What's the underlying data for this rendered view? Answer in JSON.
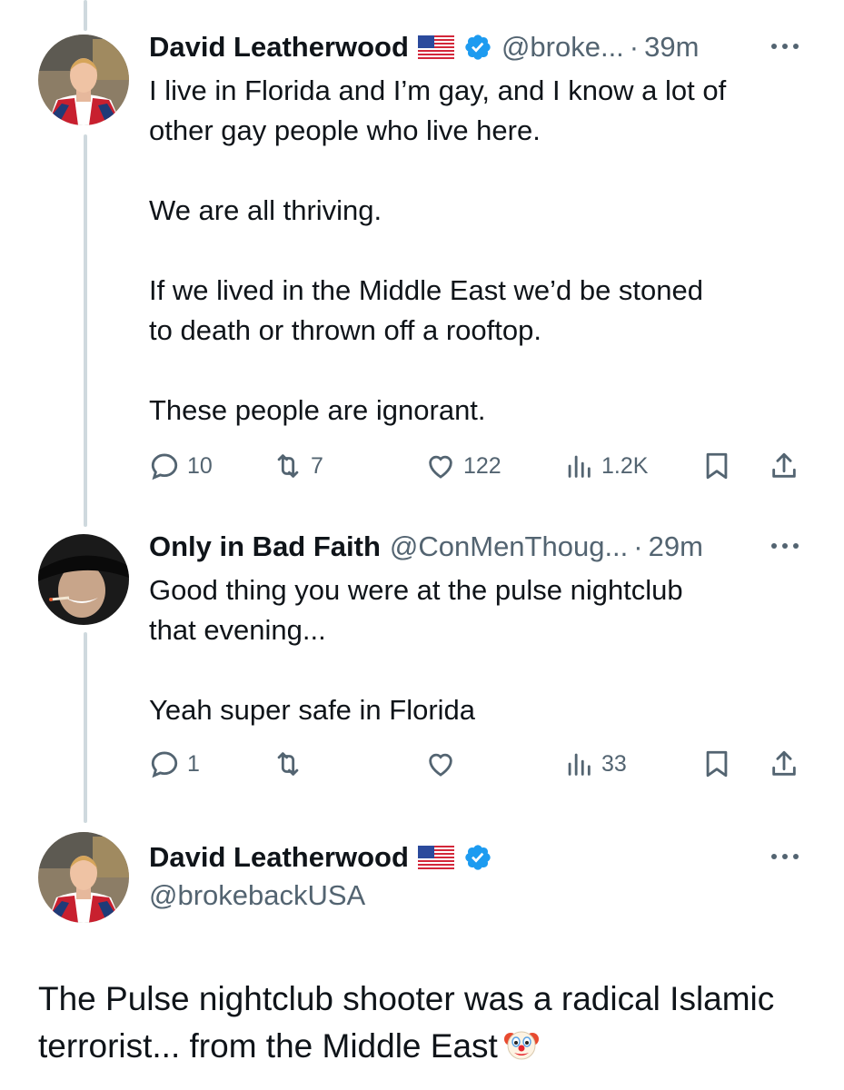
{
  "tweets": [
    {
      "name": "David Leatherwood",
      "handle": "@broke...",
      "time": "39m",
      "text": "I live in Florida and I’m gay, and I know a lot of\nother gay people who live here.\n\nWe are all thriving.\n\nIf we lived in the Middle East we’d be stoned\nto death or thrown off a rooftop.\n\nThese people are ignorant.",
      "replies": "10",
      "retweets": "7",
      "likes": "122",
      "views": "1.2K"
    },
    {
      "name": "Only in Bad Faith",
      "handle": "@ConMenThoug...",
      "time": "29m",
      "text": "Good thing you were at the pulse nightclub\nthat evening...\n\nYeah super safe in Florida",
      "replies": "1",
      "retweets": "",
      "likes": "",
      "views": "33"
    },
    {
      "name": "David Leatherwood",
      "handle": "@brokebackUSA",
      "text": "The Pulse nightclub shooter was a radical Islamic terrorist... from the Middle East"
    }
  ],
  "separator": "·",
  "colors": {
    "verified": "#1d9bf0",
    "secondary_text": "#536471",
    "thread_line": "#cfd9de"
  },
  "icons": [
    "reply-icon",
    "retweet-icon",
    "like-icon",
    "views-icon",
    "bookmark-icon",
    "share-icon",
    "more-icon",
    "verified-icon",
    "us-flag-icon",
    "clown-emoji"
  ]
}
